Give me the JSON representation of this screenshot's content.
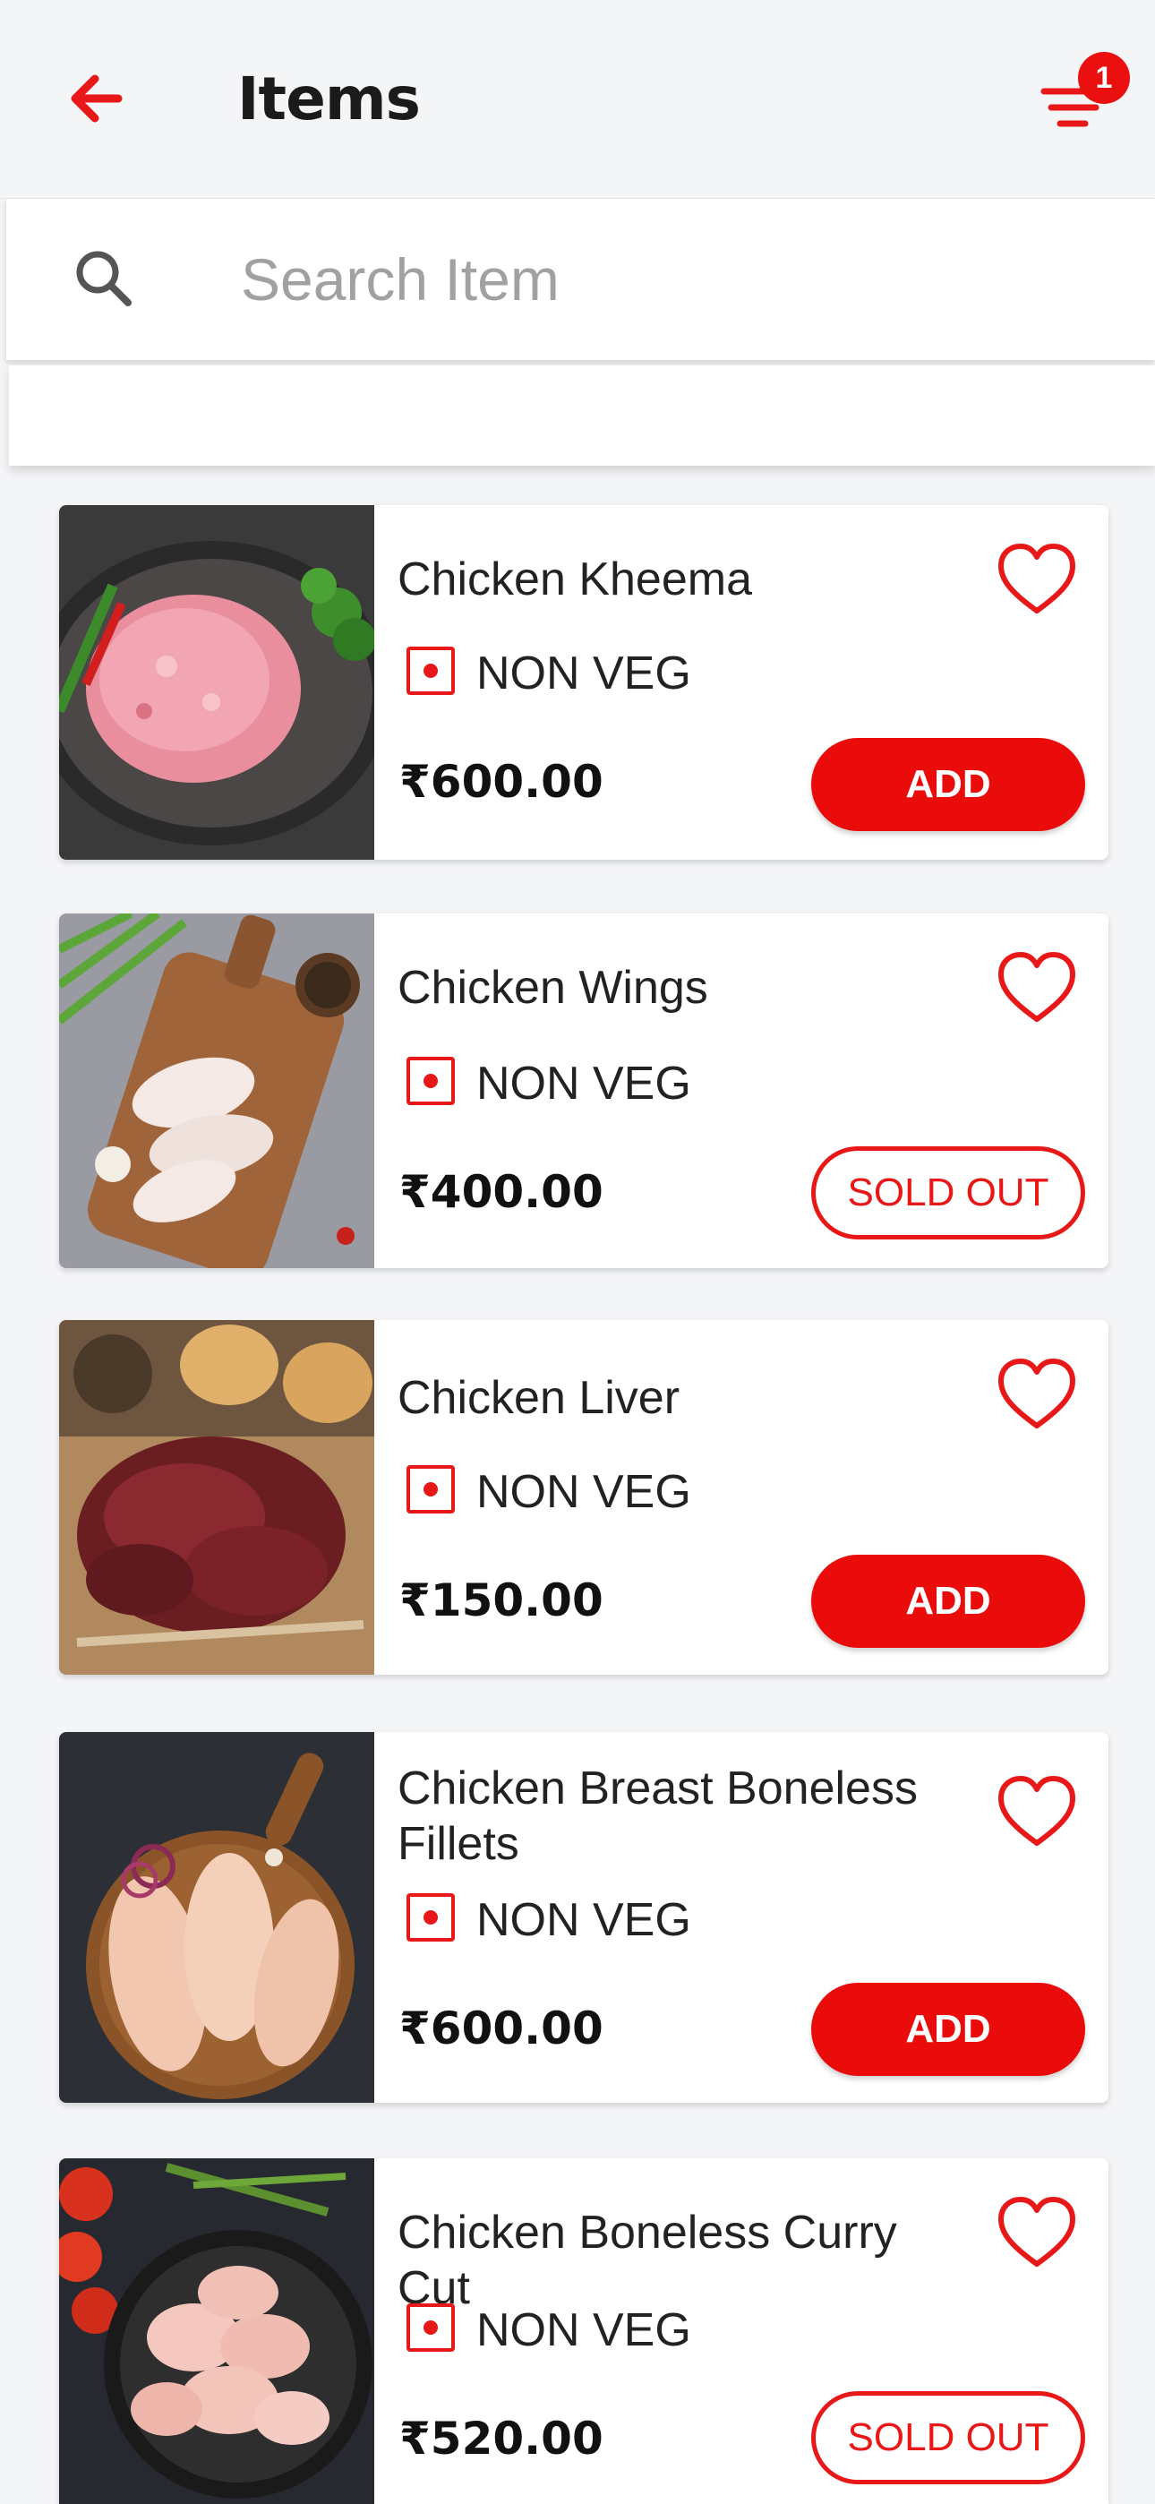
{
  "header": {
    "title": "Items",
    "filter_badge": "1"
  },
  "search": {
    "placeholder": "Search Item",
    "value": ""
  },
  "items": [
    {
      "name": "Chicken Kheema",
      "diet": "NON VEG",
      "price": "₹600.00",
      "action": "ADD",
      "available": true
    },
    {
      "name": "Chicken Wings",
      "diet": "NON VEG",
      "price": "₹400.00",
      "action": "SOLD OUT",
      "available": false
    },
    {
      "name": "Chicken Liver",
      "diet": "NON VEG",
      "price": "₹150.00",
      "action": "ADD",
      "available": true
    },
    {
      "name": "Chicken Breast Boneless Fillets",
      "diet": "NON VEG",
      "price": "₹600.00",
      "action": "ADD",
      "available": true
    },
    {
      "name": "Chicken Boneless Curry Cut",
      "diet": "NON VEG",
      "price": "₹520.00",
      "action": "SOLD OUT",
      "available": false
    }
  ],
  "colors": {
    "accent": "#ea0b0b",
    "background": "#f4f5f7",
    "card": "#ffffff",
    "text": "#222222"
  },
  "icons": {
    "back": "arrow-left-icon",
    "filter": "filter-lines-icon",
    "search": "search-icon",
    "favorite": "heart-outline-icon",
    "diet": "non-veg-mark-icon"
  }
}
